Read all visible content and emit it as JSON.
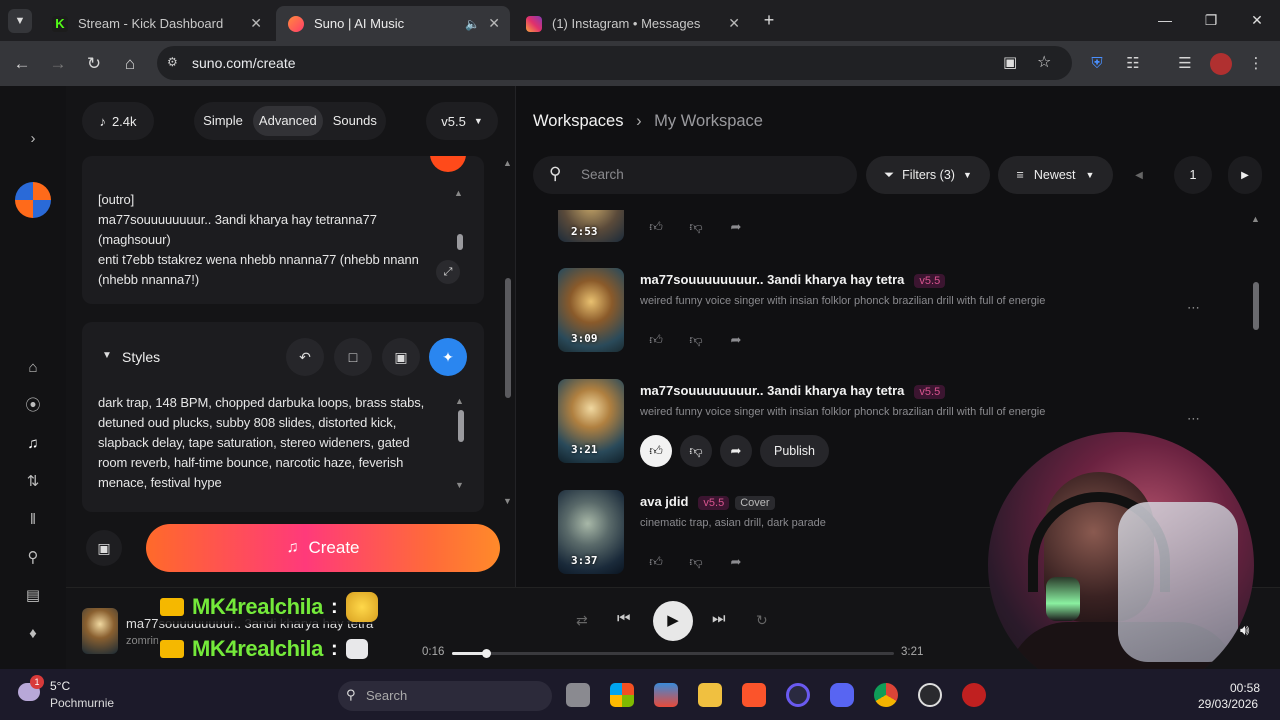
{
  "browser": {
    "tabs": [
      {
        "title": "Stream - Kick Dashboard",
        "favicon_color": "#53fc18"
      },
      {
        "title": "Suno | AI Music",
        "favicon_color": "#ff5c35",
        "active": true
      },
      {
        "title": "(1) Instagram • Messages",
        "favicon_color": "#e1306c"
      }
    ],
    "url": "suno.com/create"
  },
  "left_panel": {
    "credits": "2.4k",
    "modes": [
      "Simple",
      "Advanced",
      "Sounds"
    ],
    "active_mode": "Advanced",
    "version": "v5.5",
    "lyrics_lines": [
      "[outro]",
      "ma77souuuuuuuur.. 3andi kharya hay tetranna77",
      "(maghsouur)",
      "enti t7ebb tstakrez wena nhebb nnanna77 (nhebb nnann",
      "(nhebb nnanna7!)"
    ],
    "styles_label": "Styles",
    "styles_lines": [
      "dark trap, 148 BPM, chopped darbuka loops, brass stabs,",
      "detuned oud plucks, subby 808 slides, distorted kick,",
      "slapback delay, tape saturation, stereo wideners, gated",
      "room reverb, half-time bounce, narcotic haze, feverish",
      "menace, festival hype"
    ],
    "create_label": "Create"
  },
  "workspace": {
    "breadcrumb_root": "Workspaces",
    "breadcrumb_current": "My Workspace",
    "search_placeholder": "Search",
    "filters_label": "Filters (3)",
    "sort_label": "Newest",
    "page": "1",
    "clips": [
      {
        "duration": "2:53"
      },
      {
        "title": "ma77souuuuuuuur.. 3andi kharya hay tetra",
        "version": "v5.5",
        "desc": "weired funny voice singer with insian folklor phonck brazilian drill with full of energie",
        "duration": "3:09"
      },
      {
        "title": "ma77souuuuuuuur.. 3andi kharya hay tetra",
        "version": "v5.5",
        "desc": "weired funny voice singer with insian folklor phonck brazilian drill with full of energie",
        "duration": "3:21",
        "publish_label": "Publish"
      },
      {
        "title": "ava jdid",
        "version": "v5.5",
        "tag": "Cover",
        "desc": "cinematic trap, asian drill, dark parade",
        "duration": "3:37"
      }
    ]
  },
  "player": {
    "title": "ma77souuuuuuuur.. 3andi kharya hay tetra",
    "artist": "zomrin",
    "elapsed": "0:16",
    "total": "3:21",
    "progress": 0.076
  },
  "chat": {
    "username": "MK4realchila",
    "separator": ":"
  },
  "taskbar": {
    "weather_temp": "5°C",
    "weather_label": "Pochmurnie",
    "weather_badge": "1",
    "search_placeholder": "Search",
    "time": "00:58",
    "date": "29/03/2026"
  }
}
